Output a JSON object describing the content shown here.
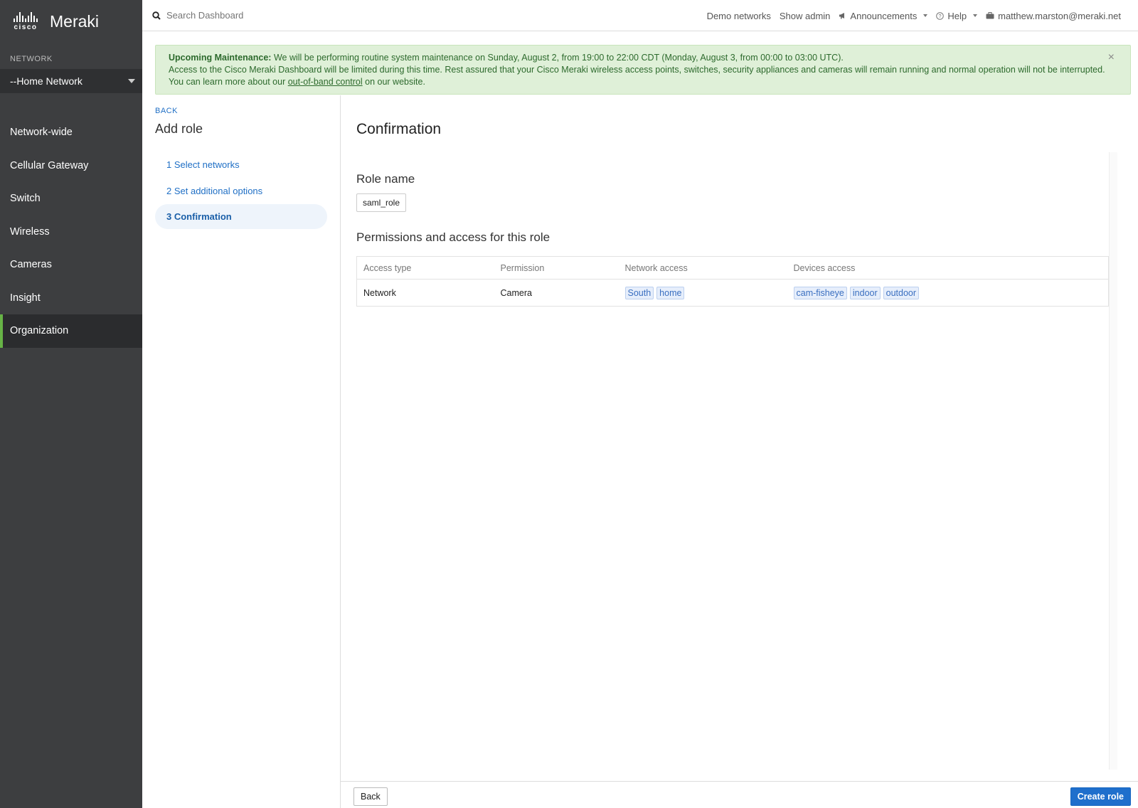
{
  "brand": {
    "cisco": "cisco",
    "meraki": "Meraki"
  },
  "sidebar": {
    "network_label": "NETWORK",
    "network_selected": "--Home Network",
    "items": [
      {
        "label": "Network-wide"
      },
      {
        "label": "Cellular Gateway"
      },
      {
        "label": "Switch"
      },
      {
        "label": "Wireless"
      },
      {
        "label": "Cameras"
      },
      {
        "label": "Insight"
      },
      {
        "label": "Organization",
        "active": true
      }
    ],
    "active_color": "#67b346"
  },
  "topbar": {
    "search_placeholder": "Search Dashboard",
    "demo_networks": "Demo networks",
    "show_admin": "Show admin",
    "announcements": "Announcements",
    "help": "Help",
    "user": "matthew.marston@meraki.net"
  },
  "banner": {
    "title": "Upcoming Maintenance:",
    "line1": "We will be performing routine system maintenance on Sunday, August 2, from 19:00 to 22:00 CDT (Monday, August 3, from 00:00 to 03:00 UTC).",
    "line2": "Access to the Cisco Meraki Dashboard will be limited during this time. Rest assured that your Cisco Meraki wireless access points, switches, security appliances and cameras will remain running and normal operation will not be interrupted. You can learn more about our",
    "link": "out-of-band control",
    "line2_end": "on our website.",
    "close": "×"
  },
  "wizard": {
    "back": "BACK",
    "title": "Add role",
    "steps": [
      {
        "label": "1 Select networks"
      },
      {
        "label": "2 Set additional options"
      },
      {
        "label": "3 Confirmation",
        "active": true
      }
    ]
  },
  "main": {
    "title": "Confirmation",
    "role_name_label": "Role name",
    "role_name": "saml_role",
    "permissions_label": "Permissions and access for this role",
    "table": {
      "headers": [
        "Access type",
        "Permission",
        "Network access",
        "Devices access"
      ],
      "rows": [
        {
          "access_type": "Network",
          "permission": "Camera",
          "networks": [
            "South",
            "home"
          ],
          "devices": [
            "cam-fisheye",
            "indoor",
            "outdoor"
          ]
        }
      ]
    }
  },
  "footer": {
    "back": "Back",
    "create": "Create role"
  }
}
